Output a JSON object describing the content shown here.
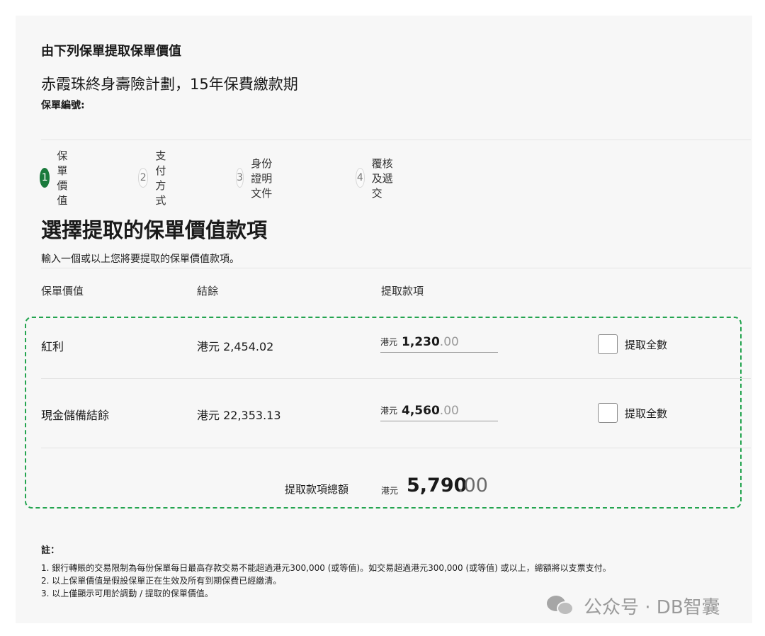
{
  "header": {
    "policy_label": "由下列保單提取保單價值",
    "plan_name": "赤霞珠終身壽險計劃，15年保費繳款期",
    "policy_number_label": "保單編號:"
  },
  "steps": [
    {
      "number": "1",
      "label": "保單價值",
      "active": true
    },
    {
      "number": "2",
      "label": "支付方式",
      "active": false
    },
    {
      "number": "3",
      "label": "身份證明文件",
      "active": false
    },
    {
      "number": "4",
      "label": "覆核及遞交",
      "active": false
    }
  ],
  "section": {
    "title": "選擇提取的保單價值款項",
    "instruction": "輸入一個或以上您將要提取的保單價值款項。"
  },
  "table": {
    "headers": [
      "保單價值",
      "結餘",
      "提取款項"
    ],
    "rows": [
      {
        "label": "紅利",
        "balance": "港元 2,454.02",
        "currency": "港元",
        "amount_int": "1,230",
        "amount_dec": ".00",
        "checkbox_label": "提取全數",
        "checked": false
      },
      {
        "label": "現金儲備結餘",
        "balance": "港元 22,353.13",
        "currency": "港元",
        "amount_int": "4,560",
        "amount_dec": ".00",
        "checkbox_label": "提取全數",
        "checked": false
      }
    ],
    "total": {
      "label": "提取款項總額",
      "currency": "港元",
      "amount_int": "5,790",
      "amount_dec": ".00"
    }
  },
  "notes": {
    "title": "註：",
    "items": [
      "1. 銀行轉賬的交易限制為每份保單每日最高存款交易不能超過港元300,000 (或等值)。如交易超過港元300,000 (或等值) 或以上，總額將以支票支付。",
      "2. 以上保單價值是假設保單正在生效及所有到期保費已經繳清。",
      "3. 以上僅顯示可用於調動 / 提取的保單價值。"
    ]
  },
  "watermark": {
    "icon": "wechat-icon",
    "text": "公众号 · DB智囊"
  },
  "colors": {
    "accent": "#1a7a3c",
    "highlight_border": "#23a44f"
  }
}
